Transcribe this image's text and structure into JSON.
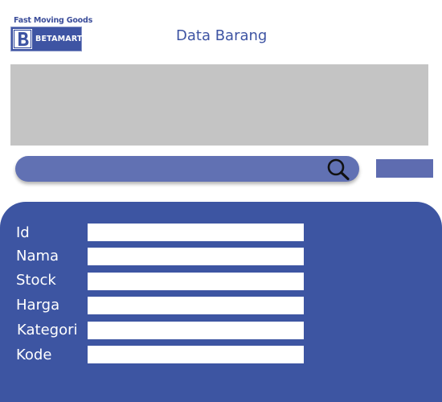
{
  "logo": {
    "tagline": "Fast Moving Goods",
    "name": "BETAMART"
  },
  "header": {
    "title": "Data Barang"
  },
  "search": {
    "value": "",
    "placeholder": ""
  },
  "form": {
    "fields": [
      {
        "label": "Id",
        "value": ""
      },
      {
        "label": "Nama",
        "value": ""
      },
      {
        "label": "Stock",
        "value": ""
      },
      {
        "label": "Harga",
        "value": ""
      },
      {
        "label": "Kategori",
        "value": ""
      },
      {
        "label": "Kode",
        "value": ""
      }
    ]
  },
  "colors": {
    "brand_blue": "#3d55a2",
    "search_blue": "#6171b3",
    "banner_gray": "#c4c4c4",
    "background": "#ffffff"
  },
  "icons": {
    "search": "search-icon",
    "logo_mark": "b-logo-mark"
  }
}
